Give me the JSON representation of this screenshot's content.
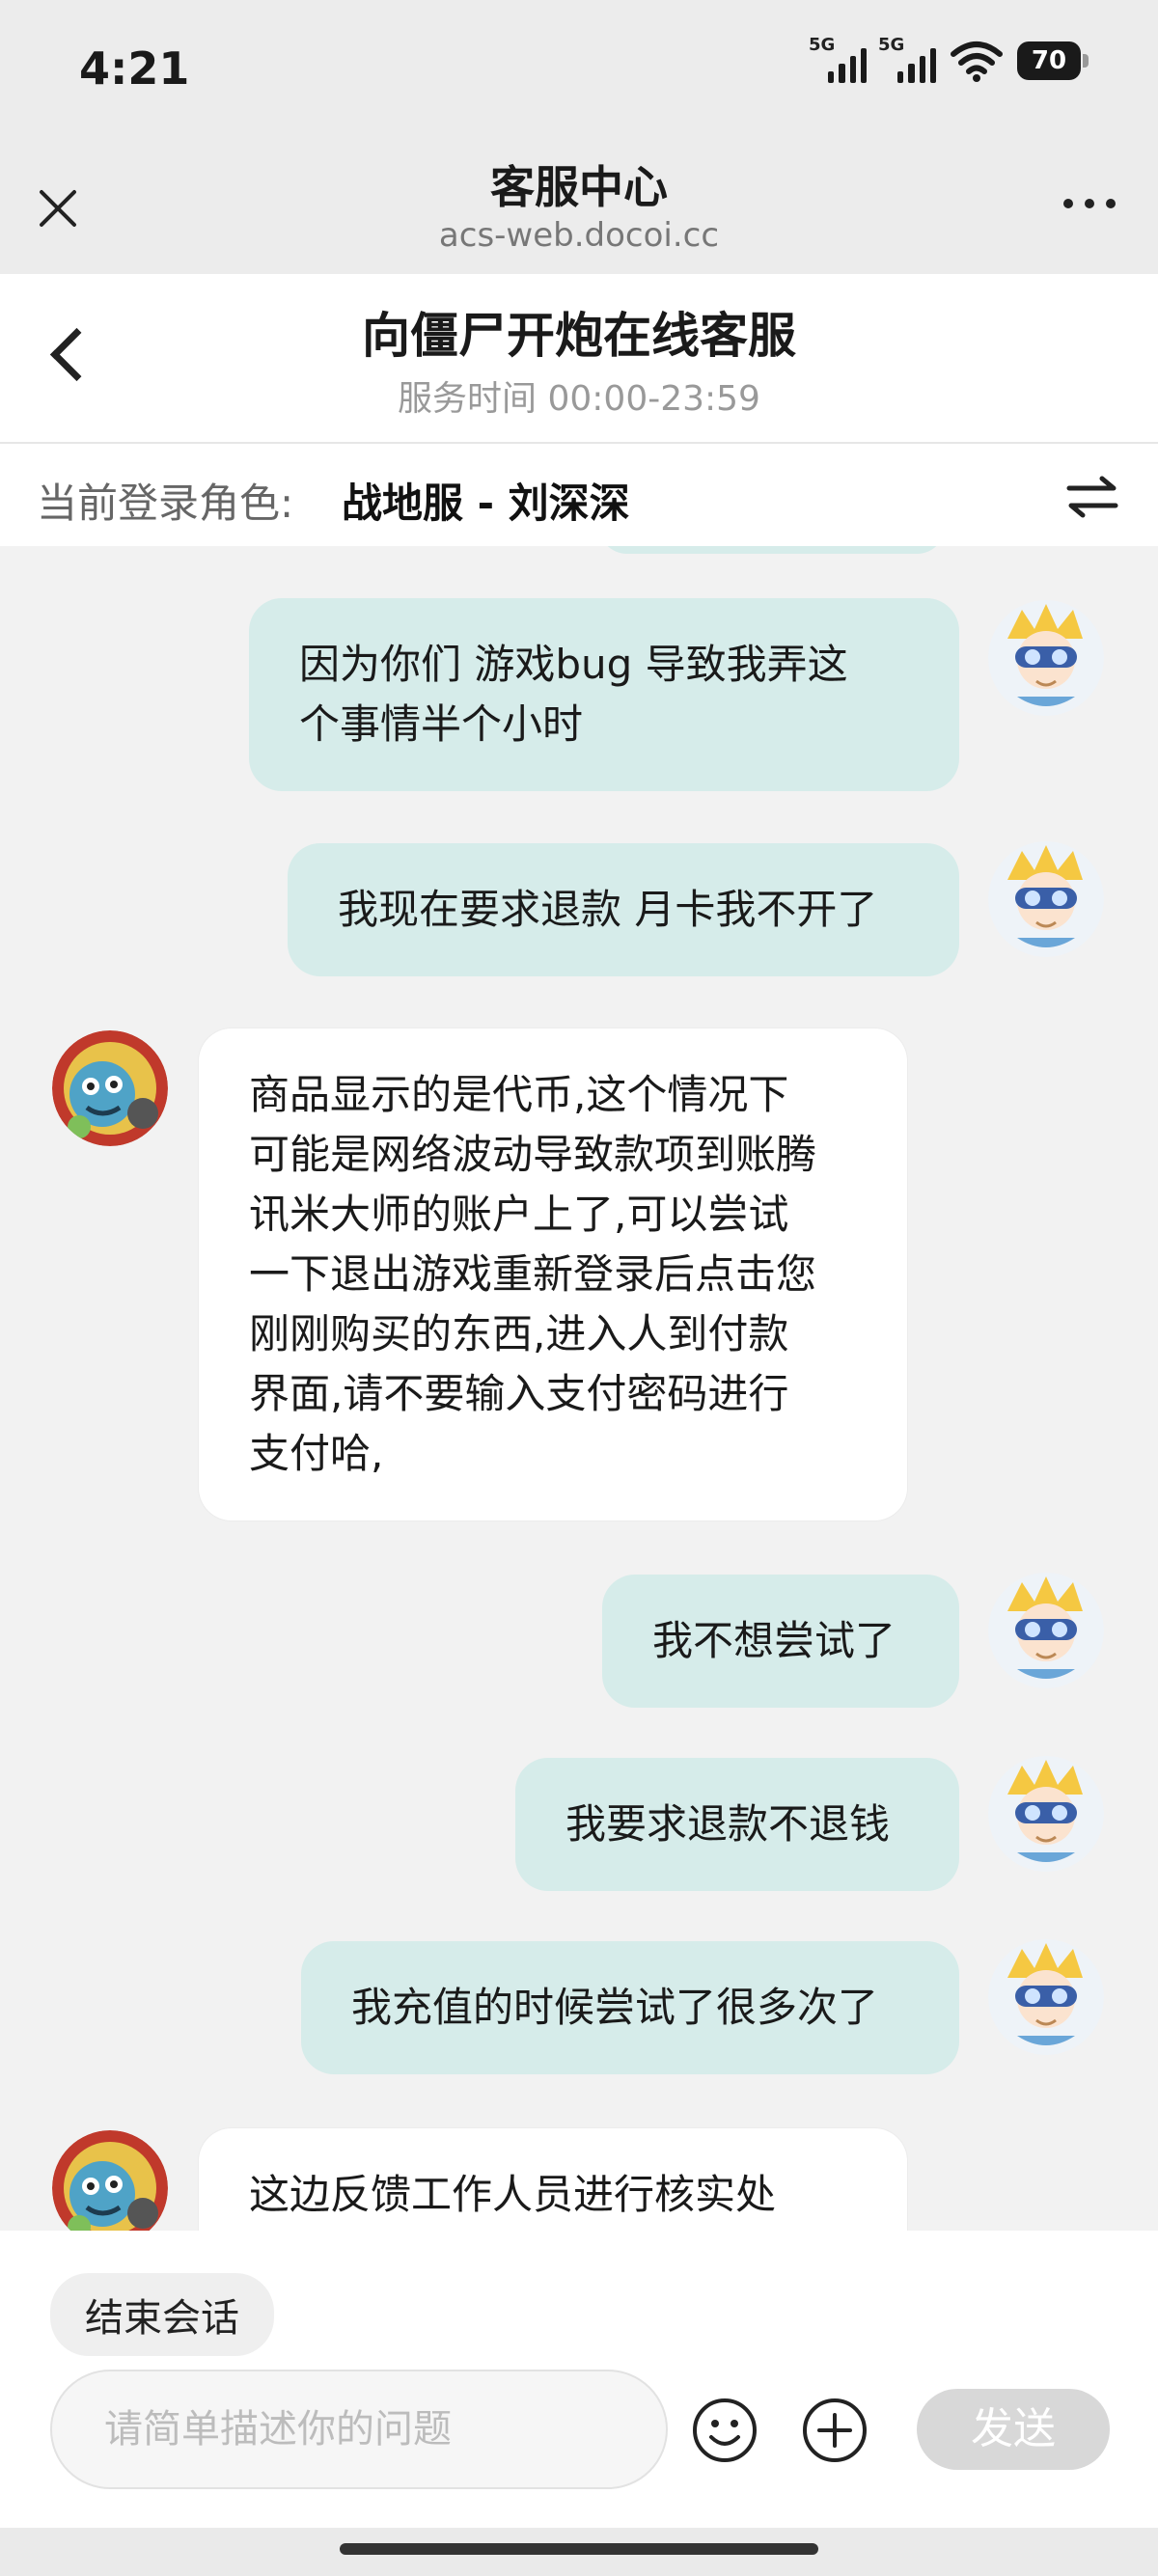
{
  "status_bar": {
    "time": "4:21",
    "sim1": "5G",
    "sim2": "5G",
    "battery": "70"
  },
  "titlebar": {
    "title": "客服中心",
    "url": "acs-web.docoi.cc"
  },
  "chat_header": {
    "title": "向僵尸开炮在线客服",
    "subtitle": "服务时间 00:00-23:59"
  },
  "role_bar": {
    "label": "当前登录角色:",
    "value": "战地服 - 刘深深"
  },
  "messages": [
    {
      "side": "out",
      "lines": [
        "因为你们 游戏bug 导致我弄这",
        "个事情半个小时"
      ]
    },
    {
      "side": "out",
      "lines": [
        "我现在要求退款 月卡我不开了"
      ]
    },
    {
      "side": "in",
      "lines": [
        "商品显示的是代币,这个情况下",
        "可能是网络波动导致款项到账腾",
        "讯米大师的账户上了,可以尝试",
        "一下退出游戏重新登录后点击您",
        "刚刚购买的东西,进入人到付款",
        "界面,请不要输入支付密码进行",
        "支付哈,"
      ]
    },
    {
      "side": "out",
      "lines": [
        "我不想尝试了"
      ]
    },
    {
      "side": "out",
      "lines": [
        "我要求退款不退钱"
      ]
    },
    {
      "side": "out",
      "lines": [
        "我充值的时候尝试了很多次了"
      ]
    },
    {
      "side": "in",
      "lines": [
        "这边反馈工作人员进行核实处"
      ]
    }
  ],
  "bottom": {
    "end_session": "结束会话",
    "input_placeholder": "请简单描述你的问题",
    "send_label": "发送"
  },
  "colors": {
    "outgoing_bubble": "#d6ecea",
    "incoming_bubble": "#ffffff",
    "send_disabled": "#d8d8d8"
  }
}
